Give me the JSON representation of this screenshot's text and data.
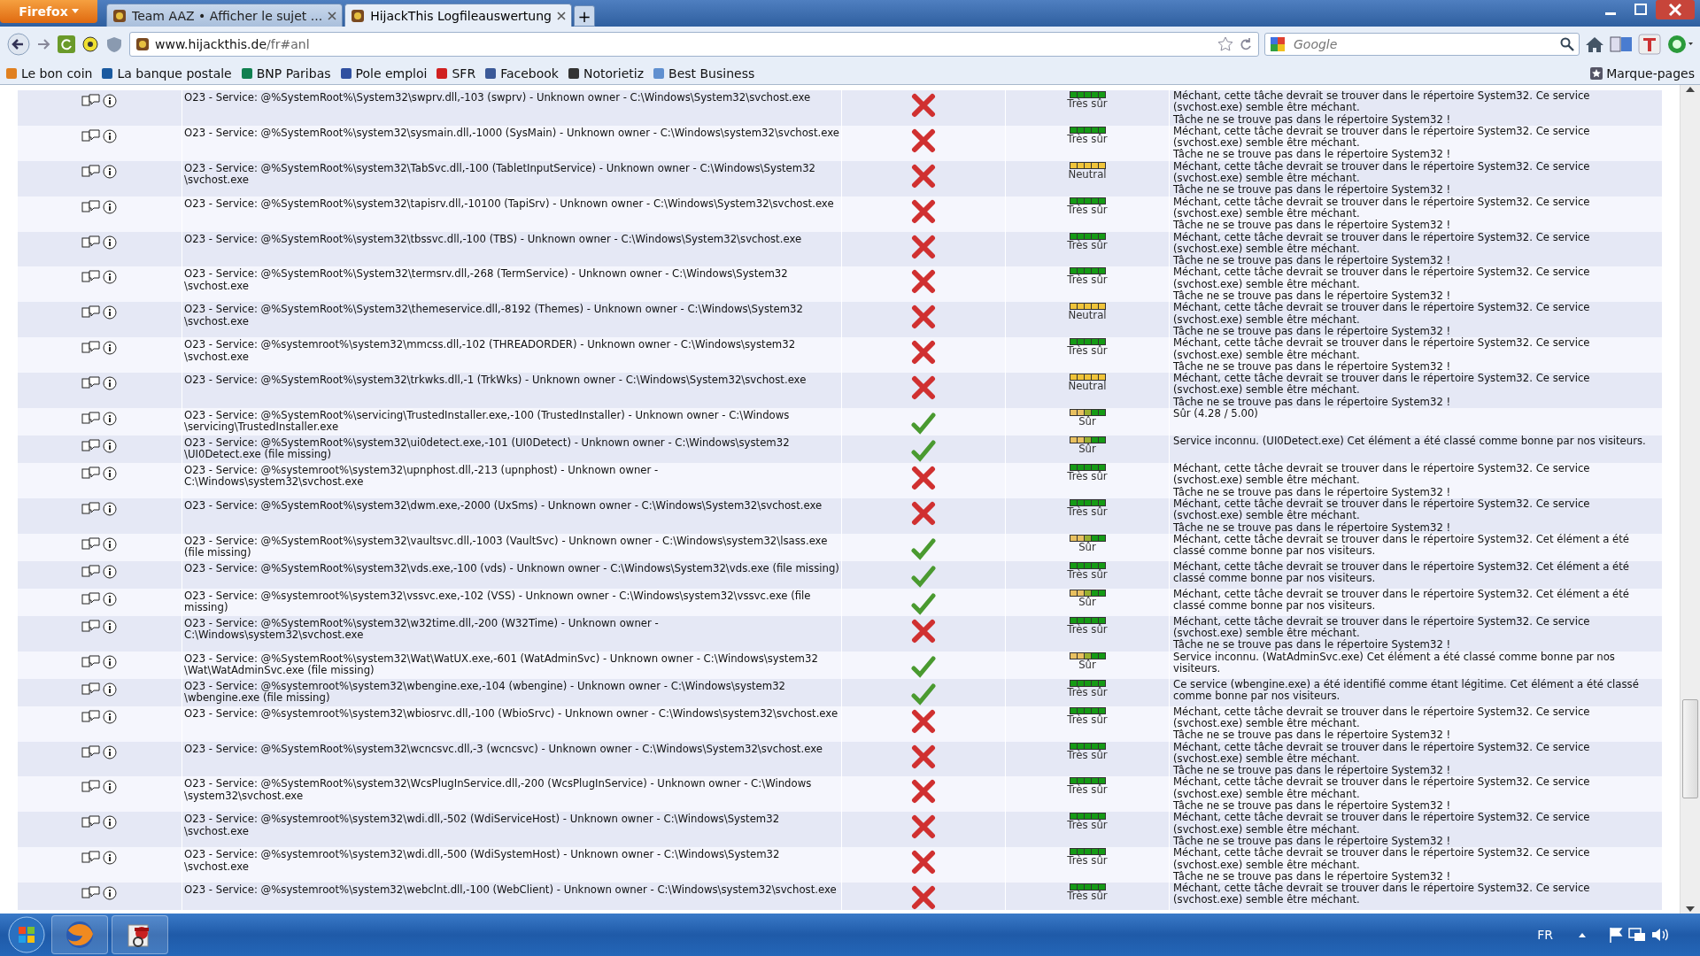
{
  "browser": {
    "app_button": "Firefox",
    "tabs": [
      {
        "title": "Team AAZ • Afficher le sujet ...",
        "selected": false
      },
      {
        "title": "HijackThis Logfileauswertung",
        "selected": true
      }
    ],
    "new_tab": "+",
    "url": {
      "host": "www.hijackthis.de",
      "path": "/fr#anl"
    },
    "search": {
      "placeholder": "Google"
    },
    "bookmarks": [
      "Le bon coin",
      "La banque postale",
      "BNP Paribas",
      "Pole emploi",
      "SFR",
      "Facebook",
      "Notorietiz",
      "Best Business"
    ],
    "bookmarks_menu": "Marque-pages"
  },
  "log": {
    "rows": [
      {
        "entry": "O23 - Service: @%SystemRoot%\\System32\\swprv.dll,-103 (swprv) - Unknown owner - C:\\Windows\\System32\\svchost.exe",
        "flagged": true,
        "rating": {
          "kind": "very_safe",
          "label": "Très sûr"
        },
        "comment": [
          "Méchant, cette tâche devrait se trouver dans le répertoire System32. Ce service (svchost.exe) semble être méchant.",
          "Tâche ne se trouve pas dans le répertoire System32 !"
        ]
      },
      {
        "entry": "O23 - Service: @%SystemRoot%\\system32\\sysmain.dll,-1000 (SysMain) - Unknown owner - C:\\Windows\\system32\\svchost.exe",
        "flagged": true,
        "rating": {
          "kind": "very_safe",
          "label": "Très sûr"
        },
        "comment": [
          "Méchant, cette tâche devrait se trouver dans le répertoire System32. Ce service (svchost.exe) semble être méchant.",
          "Tâche ne se trouve pas dans le répertoire System32 !"
        ]
      },
      {
        "entry": "O23 - Service: @%SystemRoot%\\system32\\TabSvc.dll,-100 (TabletInputService) - Unknown owner - C:\\Windows\\System32 \\svchost.exe",
        "flagged": true,
        "rating": {
          "kind": "neutral",
          "label": "Neutral"
        },
        "comment": [
          "Méchant, cette tâche devrait se trouver dans le répertoire System32. Ce service (svchost.exe) semble être méchant.",
          "Tâche ne se trouve pas dans le répertoire System32 !"
        ]
      },
      {
        "entry": "O23 - Service: @%SystemRoot%\\system32\\tapisrv.dll,-10100 (TapiSrv) - Unknown owner - C:\\Windows\\System32\\svchost.exe",
        "flagged": true,
        "rating": {
          "kind": "very_safe",
          "label": "Très sûr"
        },
        "comment": [
          "Méchant, cette tâche devrait se trouver dans le répertoire System32. Ce service (svchost.exe) semble être méchant.",
          "Tâche ne se trouve pas dans le répertoire System32 !"
        ]
      },
      {
        "entry": "O23 - Service: @%SystemRoot%\\system32\\tbssvc.dll,-100 (TBS) - Unknown owner - C:\\Windows\\System32\\svchost.exe",
        "flagged": true,
        "rating": {
          "kind": "very_safe",
          "label": "Très sûr"
        },
        "comment": [
          "Méchant, cette tâche devrait se trouver dans le répertoire System32. Ce service (svchost.exe) semble être méchant.",
          "Tâche ne se trouve pas dans le répertoire System32 !"
        ]
      },
      {
        "entry": "O23 - Service: @%SystemRoot%\\System32\\termsrv.dll,-268 (TermService) - Unknown owner - C:\\Windows\\System32 \\svchost.exe",
        "flagged": true,
        "rating": {
          "kind": "very_safe",
          "label": "Très sûr"
        },
        "comment": [
          "Méchant, cette tâche devrait se trouver dans le répertoire System32. Ce service (svchost.exe) semble être méchant.",
          "Tâche ne se trouve pas dans le répertoire System32 !"
        ]
      },
      {
        "entry": "O23 - Service: @%SystemRoot%\\System32\\themeservice.dll,-8192 (Themes) - Unknown owner - C:\\Windows\\System32 \\svchost.exe",
        "flagged": true,
        "rating": {
          "kind": "neutral",
          "label": "Neutral"
        },
        "comment": [
          "Méchant, cette tâche devrait se trouver dans le répertoire System32. Ce service (svchost.exe) semble être méchant.",
          "Tâche ne se trouve pas dans le répertoire System32 !"
        ]
      },
      {
        "entry": "O23 - Service: @%systemroot%\\system32\\mmcss.dll,-102 (THREADORDER) - Unknown owner - C:\\Windows\\system32 \\svchost.exe",
        "flagged": true,
        "rating": {
          "kind": "very_safe",
          "label": "Très sûr"
        },
        "comment": [
          "Méchant, cette tâche devrait se trouver dans le répertoire System32. Ce service (svchost.exe) semble être méchant.",
          "Tâche ne se trouve pas dans le répertoire System32 !"
        ]
      },
      {
        "entry": "O23 - Service: @%SystemRoot%\\system32\\trkwks.dll,-1 (TrkWks) - Unknown owner - C:\\Windows\\System32\\svchost.exe",
        "flagged": true,
        "rating": {
          "kind": "neutral",
          "label": "Neutral"
        },
        "comment": [
          "Méchant, cette tâche devrait se trouver dans le répertoire System32. Ce service (svchost.exe) semble être méchant.",
          "Tâche ne se trouve pas dans le répertoire System32 !"
        ]
      },
      {
        "entry": "O23 - Service: @%SystemRoot%\\servicing\\TrustedInstaller.exe,-100 (TrustedInstaller) - Unknown owner - C:\\Windows \\servicing\\TrustedInstaller.exe",
        "flagged": false,
        "rating": {
          "kind": "safe",
          "label": "Sûr"
        },
        "comment": [
          "Sûr (4.28 / 5.00)"
        ]
      },
      {
        "entry": "O23 - Service: @%SystemRoot%\\system32\\ui0detect.exe,-101 (UI0Detect) - Unknown owner - C:\\Windows\\system32 \\UI0Detect.exe (file missing)",
        "flagged": false,
        "rating": {
          "kind": "safe",
          "label": "Sûr"
        },
        "comment": [
          "Service inconnu. (UI0Detect.exe) Cet élément a été classé comme bonne par nos visiteurs."
        ]
      },
      {
        "entry": "O23 - Service: @%systemroot%\\system32\\upnphost.dll,-213 (upnphost) - Unknown owner - C:\\Windows\\system32\\svchost.exe",
        "flagged": true,
        "rating": {
          "kind": "very_safe",
          "label": "Très sûr"
        },
        "comment": [
          "Méchant, cette tâche devrait se trouver dans le répertoire System32. Ce service (svchost.exe) semble être méchant.",
          "Tâche ne se trouve pas dans le répertoire System32 !"
        ]
      },
      {
        "entry": "O23 - Service: @%SystemRoot%\\system32\\dwm.exe,-2000 (UxSms) - Unknown owner - C:\\Windows\\System32\\svchost.exe",
        "flagged": true,
        "rating": {
          "kind": "very_safe",
          "label": "Très sûr"
        },
        "comment": [
          "Méchant, cette tâche devrait se trouver dans le répertoire System32. Ce service (svchost.exe) semble être méchant.",
          "Tâche ne se trouve pas dans le répertoire System32 !"
        ]
      },
      {
        "entry": "O23 - Service: @%SystemRoot%\\system32\\vaultsvc.dll,-1003 (VaultSvc) - Unknown owner - C:\\Windows\\system32\\lsass.exe (file missing)",
        "flagged": false,
        "rating": {
          "kind": "safe",
          "label": "Sûr"
        },
        "comment": [
          "Méchant, cette tâche devrait se trouver dans le répertoire System32. Cet élément a été classé comme bonne par nos visiteurs."
        ]
      },
      {
        "entry": "O23 - Service: @%SystemRoot%\\system32\\vds.exe,-100 (vds) - Unknown owner - C:\\Windows\\System32\\vds.exe (file missing)",
        "flagged": false,
        "rating": {
          "kind": "very_safe",
          "label": "Très sûr"
        },
        "comment": [
          "Méchant, cette tâche devrait se trouver dans le répertoire System32. Cet élément a été classé comme bonne par nos visiteurs."
        ]
      },
      {
        "entry": "O23 - Service: @%systemroot%\\system32\\vssvc.exe,-102 (VSS) - Unknown owner - C:\\Windows\\system32\\vssvc.exe (file missing)",
        "flagged": false,
        "rating": {
          "kind": "safe",
          "label": "Sûr"
        },
        "comment": [
          "Méchant, cette tâche devrait se trouver dans le répertoire System32. Cet élément a été classé comme bonne par nos visiteurs."
        ]
      },
      {
        "entry": "O23 - Service: @%SystemRoot%\\system32\\w32time.dll,-200 (W32Time) - Unknown owner - C:\\Windows\\system32\\svchost.exe",
        "flagged": true,
        "rating": {
          "kind": "very_safe",
          "label": "Très sûr"
        },
        "comment": [
          "Méchant, cette tâche devrait se trouver dans le répertoire System32. Ce service (svchost.exe) semble être méchant.",
          "Tâche ne se trouve pas dans le répertoire System32 !"
        ]
      },
      {
        "entry": "O23 - Service: @%SystemRoot%\\system32\\Wat\\WatUX.exe,-601 (WatAdminSvc) - Unknown owner - C:\\Windows\\system32 \\Wat\\WatAdminSvc.exe (file missing)",
        "flagged": false,
        "rating": {
          "kind": "safe",
          "label": "Sûr"
        },
        "comment": [
          "Service inconnu. (WatAdminSvc.exe) Cet élément a été classé comme bonne par nos visiteurs."
        ]
      },
      {
        "entry": "O23 - Service: @%systemroot%\\system32\\wbengine.exe,-104 (wbengine) - Unknown owner - C:\\Windows\\system32 \\wbengine.exe (file missing)",
        "flagged": false,
        "rating": {
          "kind": "very_safe",
          "label": "Très sûr"
        },
        "comment": [
          "Ce service (wbengine.exe) a été identifié comme étant légitime. Cet élément a été classé comme bonne par nos visiteurs."
        ]
      },
      {
        "entry": "O23 - Service: @%systemroot%\\system32\\wbiosrvc.dll,-100 (WbioSrvc) - Unknown owner - C:\\Windows\\system32\\svchost.exe",
        "flagged": true,
        "rating": {
          "kind": "very_safe",
          "label": "Très sûr"
        },
        "comment": [
          "Méchant, cette tâche devrait se trouver dans le répertoire System32. Ce service (svchost.exe) semble être méchant.",
          "Tâche ne se trouve pas dans le répertoire System32 !"
        ]
      },
      {
        "entry": "O23 - Service: @%SystemRoot%\\system32\\wcncsvc.dll,-3 (wcncsvc) - Unknown owner - C:\\Windows\\System32\\svchost.exe",
        "flagged": true,
        "rating": {
          "kind": "very_safe",
          "label": "Très sûr"
        },
        "comment": [
          "Méchant, cette tâche devrait se trouver dans le répertoire System32. Ce service (svchost.exe) semble être méchant.",
          "Tâche ne se trouve pas dans le répertoire System32 !"
        ]
      },
      {
        "entry": "O23 - Service: @%SystemRoot%\\system32\\WcsPlugInService.dll,-200 (WcsPlugInService) - Unknown owner - C:\\Windows \\system32\\svchost.exe",
        "flagged": true,
        "rating": {
          "kind": "very_safe",
          "label": "Très sûr"
        },
        "comment": [
          "Méchant, cette tâche devrait se trouver dans le répertoire System32. Ce service (svchost.exe) semble être méchant.",
          "Tâche ne se trouve pas dans le répertoire System32 !"
        ]
      },
      {
        "entry": "O23 - Service: @%systemroot%\\system32\\wdi.dll,-502 (WdiServiceHost) - Unknown owner - C:\\Windows\\System32 \\svchost.exe",
        "flagged": true,
        "rating": {
          "kind": "very_safe",
          "label": "Très sûr"
        },
        "comment": [
          "Méchant, cette tâche devrait se trouver dans le répertoire System32. Ce service (svchost.exe) semble être méchant.",
          "Tâche ne se trouve pas dans le répertoire System32 !"
        ]
      },
      {
        "entry": "O23 - Service: @%systemroot%\\system32\\wdi.dll,-500 (WdiSystemHost) - Unknown owner - C:\\Windows\\System32 \\svchost.exe",
        "flagged": true,
        "rating": {
          "kind": "very_safe",
          "label": "Très sûr"
        },
        "comment": [
          "Méchant, cette tâche devrait se trouver dans le répertoire System32. Ce service (svchost.exe) semble être méchant.",
          "Tâche ne se trouve pas dans le répertoire System32 !"
        ]
      },
      {
        "entry": "O23 - Service: @%systemroot%\\system32\\webclnt.dll,-100 (WebClient) - Unknown owner - C:\\Windows\\system32\\svchost.exe",
        "flagged": true,
        "rating": {
          "kind": "very_safe",
          "label": "Très sûr"
        },
        "comment": [
          "Méchant, cette tâche devrait se trouver dans le répertoire System32. Ce service (svchost.exe) semble être méchant."
        ]
      }
    ]
  },
  "taskbar": {
    "language": "FR"
  }
}
